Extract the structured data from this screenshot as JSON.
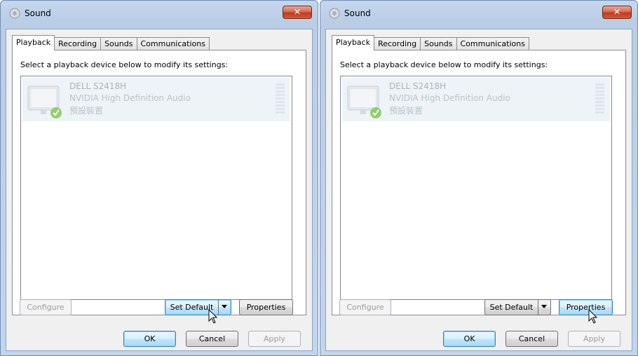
{
  "windows": [
    {
      "title": "Sound",
      "close_label": "✕",
      "tabs": [
        "Playback",
        "Recording",
        "Sounds",
        "Communications"
      ],
      "instruction": "Select a playback device below to modify its settings:",
      "device": {
        "name": "DELL S2418H",
        "description": "NVIDIA High Definition Audio",
        "status": "預設裝置"
      },
      "buttons": {
        "configure": "Configure",
        "set_default": "Set Default",
        "properties": "Properties",
        "ok": "OK",
        "cancel": "Cancel",
        "apply": "Apply"
      }
    },
    {
      "title": "Sound",
      "close_label": "✕",
      "tabs": [
        "Playback",
        "Recording",
        "Sounds",
        "Communications"
      ],
      "instruction": "Select a playback device below to modify its settings:",
      "device": {
        "name": "DELL S2418H",
        "description": "NVIDIA High Definition Audio",
        "status": "預設裝置"
      },
      "buttons": {
        "configure": "Configure",
        "set_default": "Set Default",
        "properties": "Properties",
        "ok": "OK",
        "cancel": "Cancel",
        "apply": "Apply"
      }
    }
  ],
  "icons": {
    "title": "speaker-icon",
    "device": "monitor-speaker-icon",
    "default_badge": "green-check-icon",
    "cursor": "mouse-pointer-icon"
  },
  "colors": {
    "close_button": "#c23a1f",
    "selected_row": "#eef3f8",
    "check_badge": "#6cc04a"
  }
}
